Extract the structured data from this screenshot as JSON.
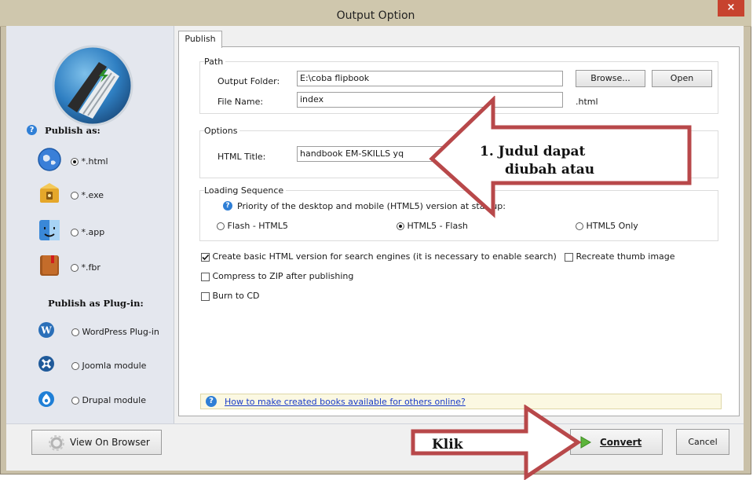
{
  "window": {
    "title": "Output Option",
    "close_glyph": "×"
  },
  "sidebar": {
    "publish_as_label": "Publish as:",
    "formats": [
      {
        "label": "*.html",
        "icon": "globe-icon",
        "selected": true
      },
      {
        "label": "*.exe",
        "icon": "exe-package-icon",
        "selected": false
      },
      {
        "label": "*.app",
        "icon": "mac-finder-icon",
        "selected": false
      },
      {
        "label": "*.fbr",
        "icon": "book-icon",
        "selected": false
      }
    ],
    "plugin_label": "Publish as Plug-in:",
    "plugins": [
      {
        "label": "WordPress Plug-in",
        "icon": "wordpress-icon",
        "selected": false
      },
      {
        "label": "Joomla module",
        "icon": "joomla-icon",
        "selected": false
      },
      {
        "label": "Drupal module",
        "icon": "drupal-icon",
        "selected": false
      }
    ],
    "help_glyph": "?"
  },
  "tabs": [
    {
      "label": "Publish"
    }
  ],
  "path": {
    "group_label": "Path",
    "output_folder_label": "Output Folder:",
    "output_folder_value": "E:\\coba flipbook",
    "browse_label": "Browse...",
    "open_label": "Open",
    "file_name_label": "File Name:",
    "file_name_value": "index",
    "extension": ".html"
  },
  "options": {
    "group_label": "Options",
    "html_title_label": "HTML Title:",
    "html_title_value": "handbook EM-SKILLS yq"
  },
  "loading": {
    "group_label": "Loading Sequence",
    "priority_text": "Priority of the desktop and mobile (HTML5) version at startup:",
    "choices": [
      {
        "label": "Flash - HTML5",
        "selected": false
      },
      {
        "label": "HTML5 - Flash",
        "selected": true
      },
      {
        "label": "HTML5 Only",
        "selected": false
      }
    ]
  },
  "checkboxes": {
    "basic_html": {
      "label": "Create basic HTML version for search engines (it is necessary to enable search)",
      "checked": true
    },
    "recreate_thumb": {
      "label": "Recreate thumb image",
      "checked": false
    },
    "compress_zip": {
      "label": "Compress to ZIP after publishing",
      "checked": false
    },
    "burn_cd": {
      "label": "Burn to CD",
      "checked": false
    }
  },
  "help_link": "How to make created books available for others online?",
  "bottom": {
    "view_browser_label": "View On Browser",
    "convert_label": "Convert",
    "cancel_label": "Cancel"
  },
  "annotations": {
    "title_callout_line1": "1. Judul dapat",
    "title_callout_line2": "diubah atau",
    "convert_callout": "Klik"
  },
  "colors": {
    "callout_border": "#b8484a",
    "titlebar": "#cfc7ad",
    "sidebar": "#e4e7ee",
    "help_blue": "#2f7fd6",
    "close_red": "#c7432f"
  }
}
